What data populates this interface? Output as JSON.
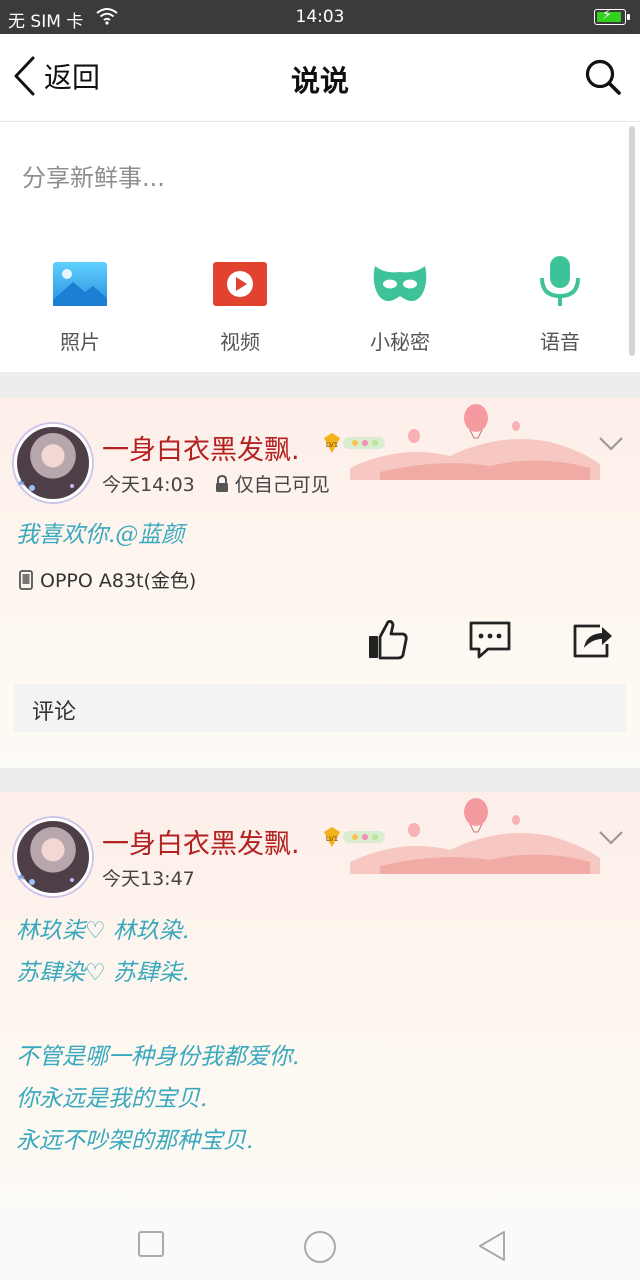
{
  "status_bar": {
    "carrier": "无 SIM 卡",
    "time": "14:03"
  },
  "nav": {
    "back_label": "返回",
    "title": "说说"
  },
  "composer": {
    "placeholder": "分享新鲜事...",
    "actions": [
      {
        "label": "照片",
        "icon": "photo-icon"
      },
      {
        "label": "视频",
        "icon": "video-icon"
      },
      {
        "label": "小秘密",
        "icon": "mask-icon"
      },
      {
        "label": "语音",
        "icon": "microphone-icon"
      }
    ]
  },
  "posts": [
    {
      "author": "一身白衣黑发飘.",
      "level": "LV1",
      "time": "今天14:03",
      "visibility": "仅自己可见",
      "lines": [
        "我喜欢你.@蓝颜"
      ],
      "device": "OPPO A83t(金色)",
      "comment_placeholder": "评论"
    },
    {
      "author": "一身白衣黑发飘.",
      "level": "LV1",
      "time": "今天13:47",
      "lines": [
        "林玖柒♡  林玖染.",
        "苏肆染♡  苏肆柒.",
        "",
        "不管是哪一种身份我都爱你.",
        "你永远是我的宝贝.",
        "永远不吵架的那种宝贝."
      ]
    }
  ],
  "colors": {
    "name_red": "#b32121",
    "text_teal": "#3aa8be",
    "mask_green": "#3dc29a",
    "video_red": "#e2432e",
    "photo_blue": "#35a6e8"
  }
}
